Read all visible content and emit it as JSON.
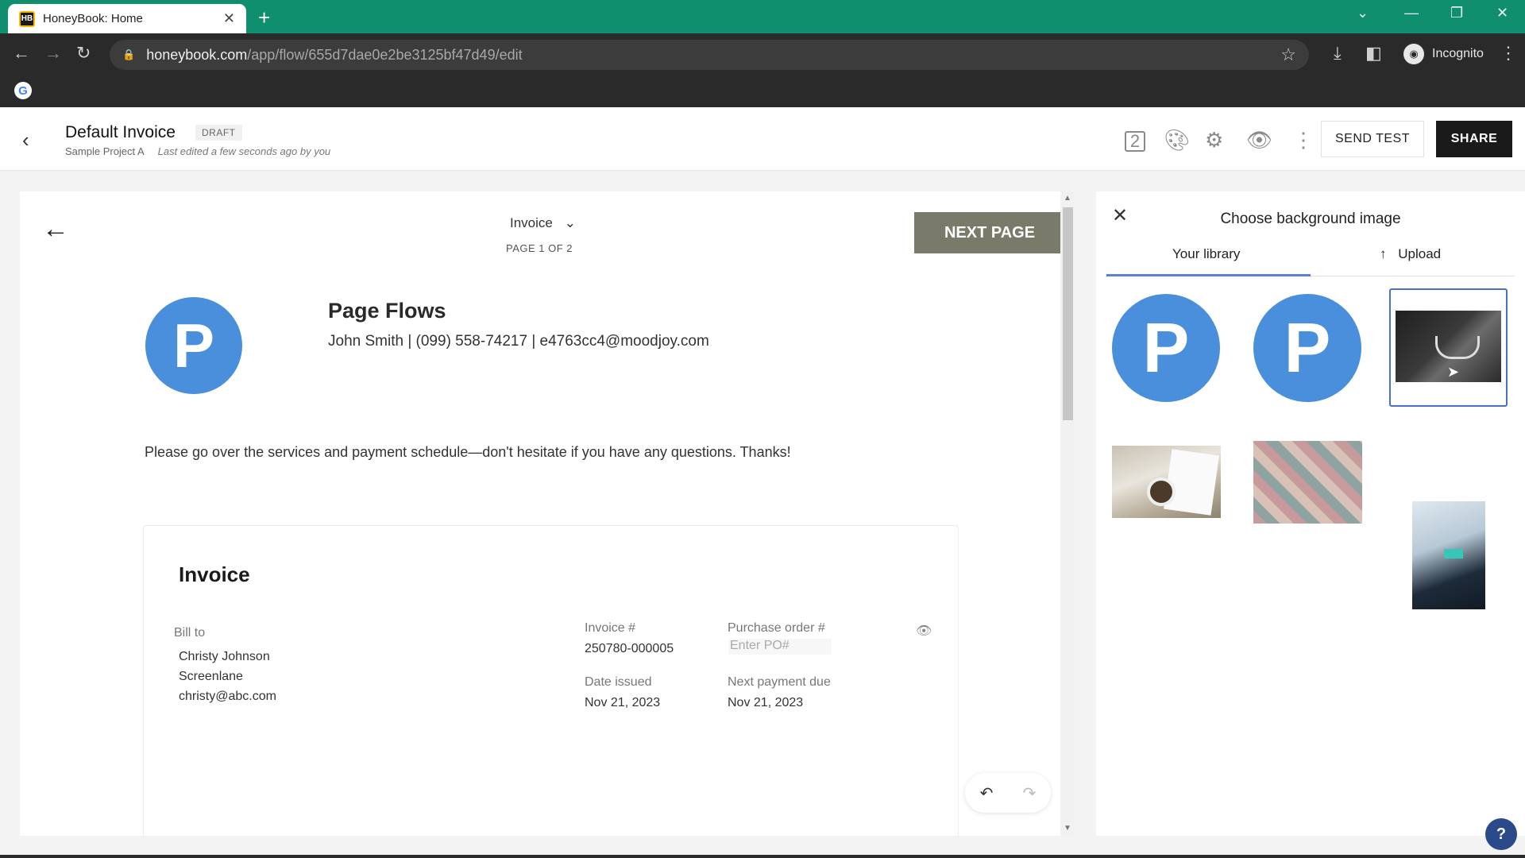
{
  "browser": {
    "tab_title": "HoneyBook: Home",
    "favicon_text": "HB",
    "url_host": "honeybook.com",
    "url_path": "/app/flow/655d7dae0e2be3125bf47d49/edit",
    "profile_label": "Incognito"
  },
  "header": {
    "title": "Default Invoice",
    "badge": "DRAFT",
    "project": "Sample Project A",
    "edited": "Last edited a few seconds ago by you",
    "page_icon_number": "2",
    "send_test": "SEND TEST",
    "share": "SHARE"
  },
  "canvas": {
    "page_selector": "Invoice",
    "page_count": "PAGE 1 OF 2",
    "next_page": "NEXT PAGE",
    "logo_letter": "P",
    "brand_name": "Page Flows",
    "brand_contact": "John Smith | (099) 558-74217 | e4763cc4@moodjoy.com",
    "intro": "Please go over the services and payment schedule—don't hesitate if you have any questions. Thanks!"
  },
  "invoice": {
    "title": "Invoice",
    "bill_to_label": "Bill to",
    "client_name": "Christy Johnson",
    "client_company": "Screenlane",
    "client_email": "christy@abc.com",
    "invoice_no_label": "Invoice #",
    "invoice_no": "250780-000005",
    "po_label": "Purchase order #",
    "po_placeholder": "Enter PO#",
    "date_issued_label": "Date issued",
    "date_issued": "Nov 21, 2023",
    "next_due_label": "Next payment due",
    "next_due": "Nov 21, 2023"
  },
  "panel": {
    "title": "Choose background image",
    "tab_library": "Your library",
    "tab_upload": "Upload",
    "thumb_letter": "P"
  },
  "help": "?",
  "colors": {
    "tabbar": "#0f8f6e",
    "brand_blue": "#4a8fdb",
    "next_page_bg": "#797a69",
    "tab_underline": "#5b7fd6"
  },
  "icons": [
    "back-icon",
    "forward-icon",
    "reload-icon",
    "lock-icon",
    "star-icon",
    "download-icon",
    "sidepanel-icon",
    "incognito-icon",
    "kebab-icon",
    "pages-icon",
    "palette-icon",
    "gear-icon",
    "eye-icon",
    "arrow-left-icon",
    "chevron-down-icon",
    "close-icon",
    "upload-arrow-icon",
    "undo-icon",
    "redo-icon",
    "help-icon"
  ]
}
